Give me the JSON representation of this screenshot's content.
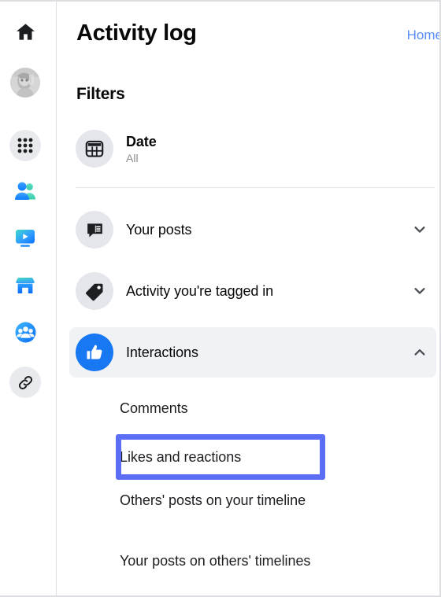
{
  "app": {
    "accent_blue": "#1877f2",
    "link_blue": "#5a8dfa",
    "highlight_box_color": "#5b6ef5",
    "selected_row_bg": "#f0f2f5"
  },
  "rail": {
    "items": [
      {
        "name": "home-icon",
        "label": "Home"
      },
      {
        "name": "avatar",
        "label": "Profile"
      },
      {
        "name": "menu-grid-icon",
        "label": "Menu"
      },
      {
        "name": "friends-icon",
        "label": "Friends"
      },
      {
        "name": "watch-icon",
        "label": "Watch"
      },
      {
        "name": "marketplace-icon",
        "label": "Marketplace"
      },
      {
        "name": "groups-icon",
        "label": "Groups"
      },
      {
        "name": "link-icon",
        "label": "Link"
      }
    ]
  },
  "header": {
    "title": "Activity log",
    "home_link": "Home"
  },
  "filters": {
    "heading": "Filters",
    "date": {
      "label": "Date",
      "value": "All",
      "icon": "calendar-icon"
    },
    "rows": [
      {
        "label": "Your posts",
        "icon": "comment-bubble-icon",
        "chevron": "chevron-down-icon",
        "expanded": false
      },
      {
        "label": "Activity you're tagged in",
        "icon": "tag-icon",
        "chevron": "chevron-down-icon",
        "expanded": false
      },
      {
        "label": "Interactions",
        "icon": "thumbs-up-icon",
        "chevron": "chevron-up-icon",
        "expanded": true
      }
    ],
    "interactions_subitems": [
      {
        "label": "Comments",
        "highlighted": false
      },
      {
        "label": "Likes and reactions",
        "highlighted": true
      },
      {
        "label": "Others' posts on your timeline",
        "highlighted": false
      },
      {
        "label": "Your posts on others' timelines",
        "highlighted": false
      }
    ]
  }
}
